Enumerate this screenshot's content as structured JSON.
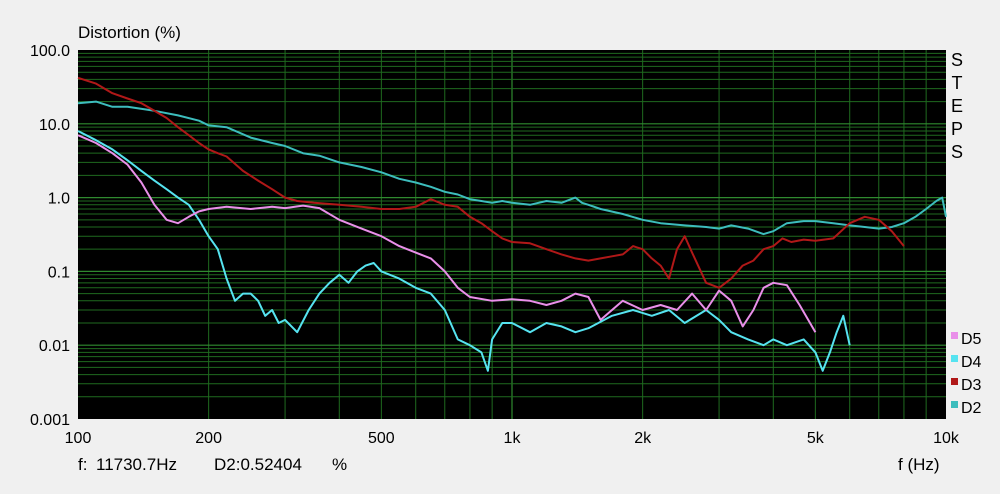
{
  "chart_data": {
    "type": "line",
    "ylabel": "Distortion (%)",
    "xlabel": "f (Hz)",
    "side_label": "STEPS",
    "x_scale": "log",
    "y_scale": "log",
    "xlim": [
      100,
      10000
    ],
    "ylim": [
      0.001,
      100
    ],
    "x_ticks": [
      {
        "value": 100,
        "label": "100"
      },
      {
        "value": 200,
        "label": "200"
      },
      {
        "value": 500,
        "label": "500"
      },
      {
        "value": 1000,
        "label": "1k"
      },
      {
        "value": 2000,
        "label": "2k"
      },
      {
        "value": 5000,
        "label": "5k"
      },
      {
        "value": 10000,
        "label": "10k"
      }
    ],
    "y_ticks": [
      {
        "value": 100,
        "label": "100.0"
      },
      {
        "value": 10,
        "label": "10.0"
      },
      {
        "value": 1,
        "label": "1.0"
      },
      {
        "value": 0.1,
        "label": "0.1"
      },
      {
        "value": 0.01,
        "label": "0.01"
      },
      {
        "value": 0.001,
        "label": "0.001"
      }
    ],
    "grid": true,
    "legend_position": "bottom-right",
    "background": "#000000",
    "grid_color": "#1f6a1f",
    "grid_major_color": "#2f8a2f",
    "readout": {
      "freq_label": "f:",
      "freq_value": "11730.7Hz",
      "measure": "D2:0.52404",
      "unit": "%"
    },
    "series": [
      {
        "name": "D2",
        "color": "#3dbdbd",
        "points": [
          [
            100,
            19
          ],
          [
            110,
            20
          ],
          [
            120,
            17
          ],
          [
            130,
            17
          ],
          [
            150,
            15
          ],
          [
            170,
            13
          ],
          [
            190,
            11
          ],
          [
            200,
            9.5
          ],
          [
            220,
            9
          ],
          [
            250,
            6.5
          ],
          [
            280,
            5.5
          ],
          [
            300,
            5
          ],
          [
            330,
            4
          ],
          [
            360,
            3.7
          ],
          [
            400,
            3
          ],
          [
            450,
            2.6
          ],
          [
            500,
            2.2
          ],
          [
            550,
            1.8
          ],
          [
            600,
            1.6
          ],
          [
            650,
            1.4
          ],
          [
            700,
            1.2
          ],
          [
            750,
            1.1
          ],
          [
            800,
            0.95
          ],
          [
            850,
            0.9
          ],
          [
            900,
            0.85
          ],
          [
            950,
            0.9
          ],
          [
            1000,
            0.85
          ],
          [
            1100,
            0.8
          ],
          [
            1200,
            0.9
          ],
          [
            1300,
            0.85
          ],
          [
            1400,
            1.0
          ],
          [
            1450,
            0.85
          ],
          [
            1500,
            0.8
          ],
          [
            1600,
            0.7
          ],
          [
            1800,
            0.6
          ],
          [
            2000,
            0.5
          ],
          [
            2200,
            0.45
          ],
          [
            2500,
            0.42
          ],
          [
            2800,
            0.4
          ],
          [
            3000,
            0.38
          ],
          [
            3200,
            0.42
          ],
          [
            3500,
            0.38
          ],
          [
            3800,
            0.32
          ],
          [
            4000,
            0.35
          ],
          [
            4300,
            0.45
          ],
          [
            4700,
            0.48
          ],
          [
            5000,
            0.48
          ],
          [
            5500,
            0.45
          ],
          [
            6000,
            0.42
          ],
          [
            6500,
            0.4
          ],
          [
            7000,
            0.38
          ],
          [
            7500,
            0.4
          ],
          [
            8000,
            0.45
          ],
          [
            8500,
            0.55
          ],
          [
            9000,
            0.7
          ],
          [
            9500,
            0.9
          ],
          [
            9800,
            1.0
          ],
          [
            10000,
            0.55
          ]
        ]
      },
      {
        "name": "D3",
        "color": "#b01818",
        "points": [
          [
            100,
            42
          ],
          [
            110,
            35
          ],
          [
            120,
            26
          ],
          [
            130,
            22
          ],
          [
            140,
            19
          ],
          [
            150,
            15
          ],
          [
            160,
            12
          ],
          [
            170,
            9
          ],
          [
            180,
            7
          ],
          [
            190,
            5.5
          ],
          [
            200,
            4.5
          ],
          [
            210,
            4
          ],
          [
            220,
            3.6
          ],
          [
            240,
            2.3
          ],
          [
            260,
            1.7
          ],
          [
            280,
            1.3
          ],
          [
            300,
            1.0
          ],
          [
            320,
            0.9
          ],
          [
            350,
            0.85
          ],
          [
            400,
            0.8
          ],
          [
            450,
            0.75
          ],
          [
            500,
            0.7
          ],
          [
            550,
            0.7
          ],
          [
            600,
            0.75
          ],
          [
            650,
            0.95
          ],
          [
            700,
            0.8
          ],
          [
            750,
            0.75
          ],
          [
            800,
            0.55
          ],
          [
            850,
            0.45
          ],
          [
            900,
            0.35
          ],
          [
            950,
            0.28
          ],
          [
            1000,
            0.25
          ],
          [
            1100,
            0.24
          ],
          [
            1200,
            0.2
          ],
          [
            1300,
            0.17
          ],
          [
            1400,
            0.15
          ],
          [
            1500,
            0.14
          ],
          [
            1600,
            0.15
          ],
          [
            1700,
            0.16
          ],
          [
            1800,
            0.17
          ],
          [
            1900,
            0.22
          ],
          [
            2000,
            0.2
          ],
          [
            2100,
            0.15
          ],
          [
            2200,
            0.12
          ],
          [
            2300,
            0.08
          ],
          [
            2400,
            0.2
          ],
          [
            2500,
            0.3
          ],
          [
            2600,
            0.18
          ],
          [
            2800,
            0.07
          ],
          [
            3000,
            0.06
          ],
          [
            3200,
            0.08
          ],
          [
            3400,
            0.12
          ],
          [
            3600,
            0.14
          ],
          [
            3800,
            0.2
          ],
          [
            4000,
            0.22
          ],
          [
            4200,
            0.28
          ],
          [
            4400,
            0.25
          ],
          [
            4700,
            0.27
          ],
          [
            5000,
            0.26
          ],
          [
            5500,
            0.28
          ],
          [
            6000,
            0.45
          ],
          [
            6500,
            0.55
          ],
          [
            7000,
            0.5
          ],
          [
            7500,
            0.35
          ],
          [
            8000,
            0.22
          ]
        ]
      },
      {
        "name": "D4",
        "color": "#56e3f0",
        "points": [
          [
            100,
            8
          ],
          [
            110,
            6
          ],
          [
            120,
            4.5
          ],
          [
            130,
            3.2
          ],
          [
            140,
            2.3
          ],
          [
            150,
            1.7
          ],
          [
            160,
            1.3
          ],
          [
            170,
            1.0
          ],
          [
            180,
            0.8
          ],
          [
            190,
            0.5
          ],
          [
            200,
            0.3
          ],
          [
            210,
            0.2
          ],
          [
            220,
            0.08
          ],
          [
            230,
            0.04
          ],
          [
            240,
            0.05
          ],
          [
            250,
            0.05
          ],
          [
            260,
            0.04
          ],
          [
            270,
            0.025
          ],
          [
            280,
            0.03
          ],
          [
            290,
            0.02
          ],
          [
            300,
            0.022
          ],
          [
            320,
            0.015
          ],
          [
            340,
            0.03
          ],
          [
            360,
            0.05
          ],
          [
            380,
            0.07
          ],
          [
            400,
            0.09
          ],
          [
            420,
            0.07
          ],
          [
            440,
            0.1
          ],
          [
            460,
            0.12
          ],
          [
            480,
            0.13
          ],
          [
            500,
            0.1
          ],
          [
            550,
            0.08
          ],
          [
            600,
            0.06
          ],
          [
            650,
            0.05
          ],
          [
            700,
            0.03
          ],
          [
            750,
            0.012
          ],
          [
            800,
            0.01
          ],
          [
            850,
            0.008
          ],
          [
            880,
            0.0045
          ],
          [
            900,
            0.012
          ],
          [
            950,
            0.02
          ],
          [
            1000,
            0.02
          ],
          [
            1100,
            0.015
          ],
          [
            1200,
            0.02
          ],
          [
            1300,
            0.018
          ],
          [
            1400,
            0.015
          ],
          [
            1500,
            0.017
          ],
          [
            1700,
            0.025
          ],
          [
            1900,
            0.03
          ],
          [
            2100,
            0.025
          ],
          [
            2300,
            0.03
          ],
          [
            2500,
            0.02
          ],
          [
            2800,
            0.03
          ],
          [
            3000,
            0.022
          ],
          [
            3200,
            0.015
          ],
          [
            3500,
            0.012
          ],
          [
            3800,
            0.01
          ],
          [
            4000,
            0.012
          ],
          [
            4300,
            0.01
          ],
          [
            4700,
            0.012
          ],
          [
            5000,
            0.008
          ],
          [
            5200,
            0.0045
          ],
          [
            5400,
            0.008
          ],
          [
            5600,
            0.015
          ],
          [
            5800,
            0.025
          ],
          [
            6000,
            0.01
          ]
        ]
      },
      {
        "name": "D5",
        "color": "#e98fe9",
        "points": [
          [
            100,
            7
          ],
          [
            110,
            5.5
          ],
          [
            120,
            4
          ],
          [
            130,
            2.8
          ],
          [
            140,
            1.6
          ],
          [
            150,
            0.8
          ],
          [
            160,
            0.5
          ],
          [
            170,
            0.45
          ],
          [
            180,
            0.55
          ],
          [
            190,
            0.65
          ],
          [
            200,
            0.7
          ],
          [
            220,
            0.75
          ],
          [
            250,
            0.7
          ],
          [
            280,
            0.75
          ],
          [
            300,
            0.72
          ],
          [
            330,
            0.78
          ],
          [
            360,
            0.72
          ],
          [
            400,
            0.5
          ],
          [
            450,
            0.38
          ],
          [
            500,
            0.3
          ],
          [
            550,
            0.22
          ],
          [
            600,
            0.18
          ],
          [
            650,
            0.15
          ],
          [
            700,
            0.1
          ],
          [
            750,
            0.06
          ],
          [
            800,
            0.045
          ],
          [
            900,
            0.04
          ],
          [
            1000,
            0.042
          ],
          [
            1100,
            0.04
          ],
          [
            1200,
            0.035
          ],
          [
            1300,
            0.04
          ],
          [
            1400,
            0.05
          ],
          [
            1500,
            0.045
          ],
          [
            1600,
            0.022
          ],
          [
            1700,
            0.03
          ],
          [
            1800,
            0.04
          ],
          [
            2000,
            0.03
          ],
          [
            2200,
            0.035
          ],
          [
            2400,
            0.03
          ],
          [
            2600,
            0.05
          ],
          [
            2800,
            0.03
          ],
          [
            3000,
            0.055
          ],
          [
            3200,
            0.04
          ],
          [
            3400,
            0.018
          ],
          [
            3600,
            0.03
          ],
          [
            3800,
            0.06
          ],
          [
            4000,
            0.07
          ],
          [
            4300,
            0.065
          ],
          [
            4600,
            0.035
          ],
          [
            5000,
            0.015
          ]
        ]
      }
    ]
  }
}
